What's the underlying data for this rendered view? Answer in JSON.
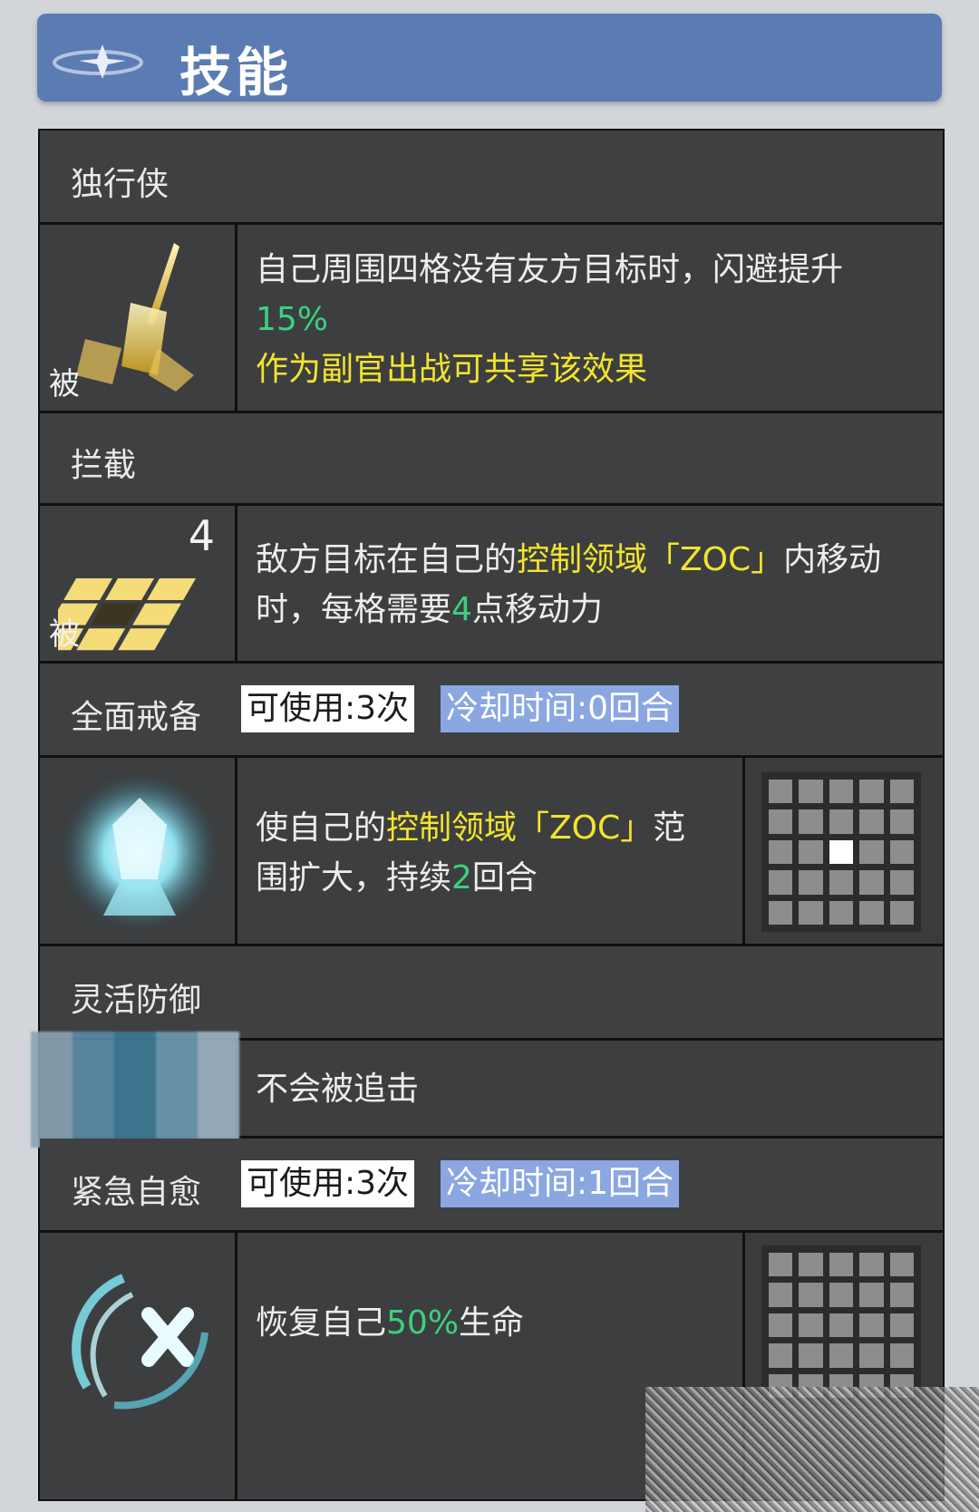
{
  "header": {
    "title": "技能"
  },
  "skills": [
    {
      "name": "独行侠",
      "passive_label": "被",
      "desc_line1": "自己周围四格没有友方目标时，闪避提升",
      "desc_value": "15%",
      "desc_line3": "作为副官出战可共享该效果"
    },
    {
      "name": "拦截",
      "passive_label": "被",
      "icon_number": "4",
      "desc_a": "敌方目标在自己的",
      "desc_zoc": "控制领域「ZOC」",
      "desc_b": "内移动",
      "desc_c": "时，每格需要",
      "desc_value": "4",
      "desc_d": "点移动力"
    },
    {
      "name": "全面戒备",
      "uses": "可使用:3次",
      "cooldown": "冷却时间:0回合",
      "desc_a": "使自己的",
      "desc_zoc": "控制领域「ZOC」",
      "desc_b": "范",
      "desc_c": "围扩大，持续",
      "desc_value": "2",
      "desc_d": "回合"
    },
    {
      "name": "灵活防御",
      "desc": "不会被追击"
    },
    {
      "name": "紧急自愈",
      "uses": "可使用:3次",
      "cooldown": "冷却时间:1回合",
      "desc_a": "恢复自己",
      "desc_value": "50%",
      "desc_b": "生命"
    }
  ]
}
